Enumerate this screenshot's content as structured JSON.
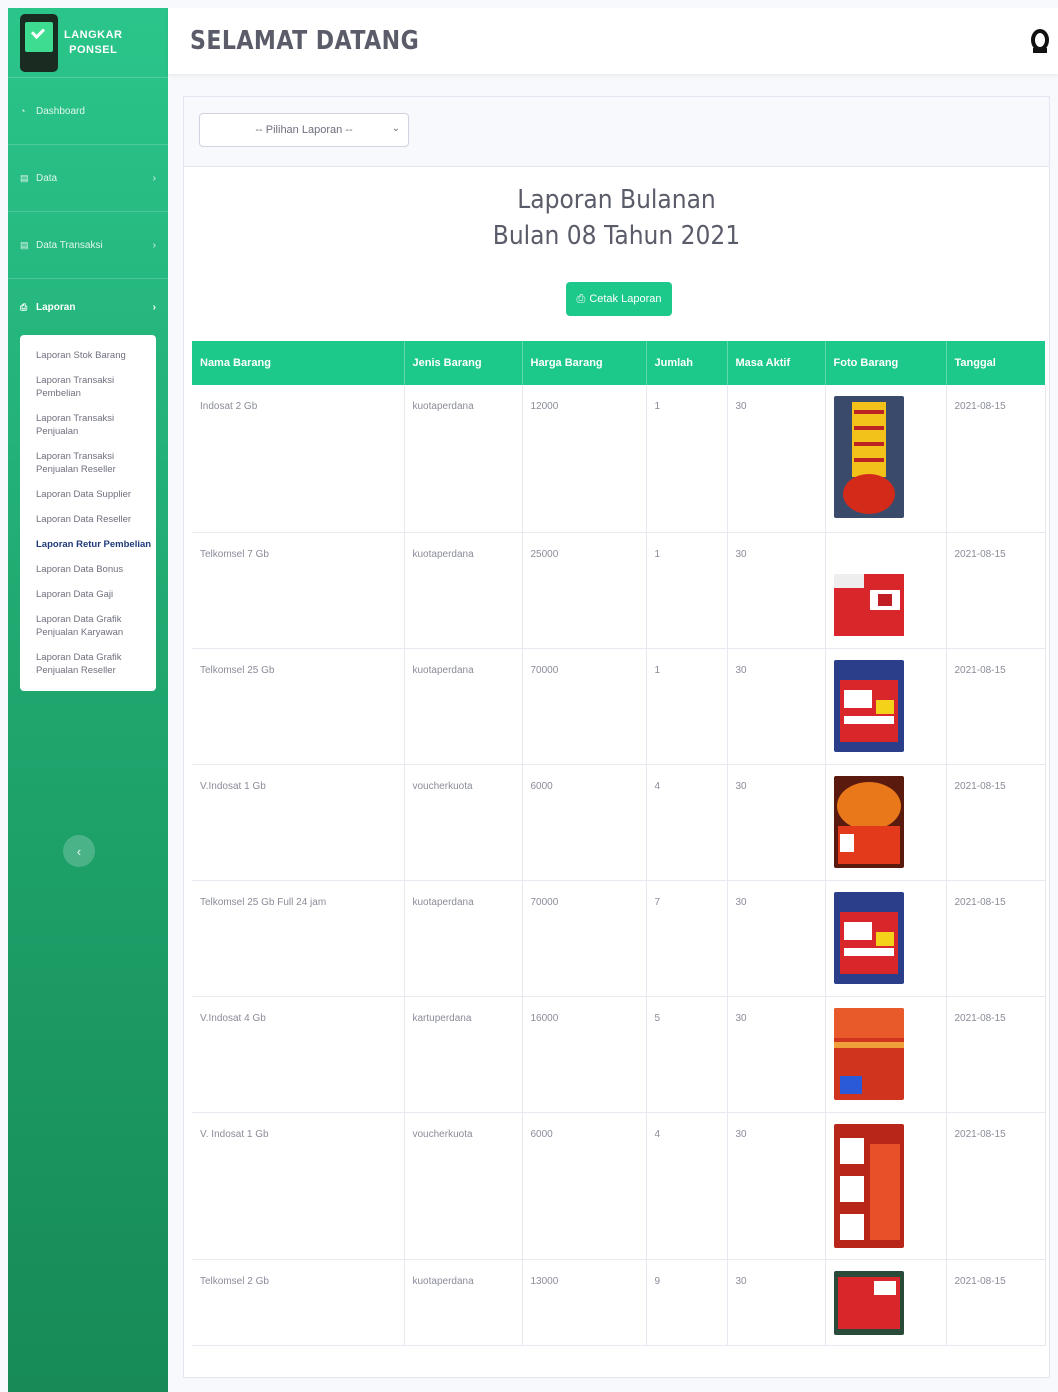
{
  "brand": {
    "line1": "LANGKAR",
    "line2": "PONSEL"
  },
  "sidebar": {
    "items": [
      {
        "label": "Dashboard",
        "icon": "tachometer-icon",
        "chevron": ""
      },
      {
        "label": "Data",
        "icon": "folder-icon",
        "chevron": "›"
      },
      {
        "label": "Data Transaksi",
        "icon": "folder-icon",
        "chevron": "›"
      },
      {
        "label": "Laporan",
        "icon": "print-icon",
        "chevron": "›"
      }
    ],
    "submenu": [
      "Laporan Stok Barang",
      "Laporan Transaksi Pembelian",
      "Laporan Transaksi Penjualan",
      "Laporan Transaksi Penjualan Reseller",
      "Laporan Data Supplier",
      "Laporan Data Reseller",
      "Laporan Retur Pembelian",
      "Laporan Data Bonus",
      "Laporan Data Gaji",
      "Laporan Data Grafik Penjualan Karyawan",
      "Laporan Data Grafik Penjualan Reseller"
    ],
    "toggle_glyph": "‹"
  },
  "header": {
    "title": "SELAMAT DATANG",
    "user_icon": "user-icon"
  },
  "filter": {
    "select_value": "-- Pilihan Laporan --"
  },
  "report": {
    "title": "Laporan Bulanan",
    "subtitle": "Bulan 08  Tahun 2021",
    "print_label": "Cetak Laporan"
  },
  "table": {
    "columns": [
      "Nama Barang",
      "Jenis Barang",
      "Harga Barang",
      "Jumlah",
      "Masa Aktif",
      "Foto Barang",
      "Tanggal"
    ],
    "rows": [
      {
        "nama": "Indosat 2 Gb",
        "jenis": "kuotaperdana",
        "harga": "12000",
        "jumlah": "1",
        "masa": "30",
        "tanggal": "2021-08-15"
      },
      {
        "nama": "Telkomsel 7 Gb",
        "jenis": "kuotaperdana",
        "harga": "25000",
        "jumlah": "1",
        "masa": "30",
        "tanggal": "2021-08-15"
      },
      {
        "nama": "Telkomsel 25 Gb",
        "jenis": "kuotaperdana",
        "harga": "70000",
        "jumlah": "1",
        "masa": "30",
        "tanggal": "2021-08-15"
      },
      {
        "nama": "V.Indosat 1 Gb",
        "jenis": "voucherkuota",
        "harga": "6000",
        "jumlah": "4",
        "masa": "30",
        "tanggal": "2021-08-15"
      },
      {
        "nama": "Telkomsel 25 Gb Full 24 jam",
        "jenis": "kuotaperdana",
        "harga": "70000",
        "jumlah": "7",
        "masa": "30",
        "tanggal": "2021-08-15"
      },
      {
        "nama": "V.Indosat 4 Gb",
        "jenis": "kartuperdana",
        "harga": "16000",
        "jumlah": "5",
        "masa": "30",
        "tanggal": "2021-08-15"
      },
      {
        "nama": "V. Indosat 1 Gb",
        "jenis": "voucherkuota",
        "harga": "6000",
        "jumlah": "4",
        "masa": "30",
        "tanggal": "2021-08-15"
      },
      {
        "nama": "Telkomsel 2 Gb",
        "jenis": "kuotaperdana",
        "harga": "13000",
        "jumlah": "9",
        "masa": "30",
        "tanggal": "2021-08-15"
      }
    ]
  },
  "colors": {
    "accent": "#1cc88a",
    "sidebar_top": "#2bc58a",
    "sidebar_bottom": "#178a57"
  }
}
